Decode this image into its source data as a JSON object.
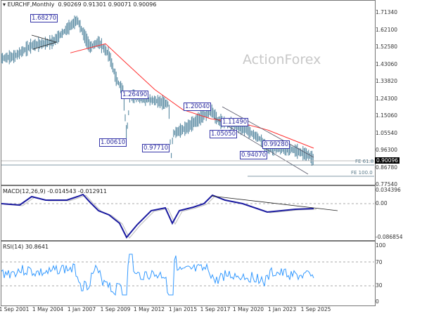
{
  "chart": {
    "symbol": "EURCHF,Monthly",
    "ohlc": "0.90269 0.91301 0.90071 0.90096",
    "watermark": "ActionForex",
    "current_price": "0.90096",
    "price_axis": [
      "1.71340",
      "1.62100",
      "1.52580",
      "1.43060",
      "1.33820",
      "1.24300",
      "1.15060",
      "1.05540",
      "0.96300",
      "0.86780",
      "0.77540"
    ],
    "labels": [
      "1.68270",
      "1.26490",
      "1.00610",
      "0.97710",
      "1.20040",
      "1.11490",
      "1.05050",
      "0.94070",
      "0.99280"
    ],
    "fe": [
      "FE 61.8",
      "FE 100.0"
    ]
  },
  "macd": {
    "title": "MACD(12,26,9) -0.014543 -0.012911",
    "axis": [
      "0.034396",
      "0.00",
      "-0.086854"
    ]
  },
  "rsi": {
    "title": "RSI(14) 30.8641",
    "axis": [
      "100",
      "70",
      "30",
      "0"
    ]
  },
  "x_axis": [
    "1 Sep 2001",
    "1 May 2004",
    "1 Jan 2007",
    "1 Sep 2009",
    "1 May 2012",
    "1 Jan 2015",
    "1 Sep 2017",
    "1 May 2020",
    "1 Jan 2023",
    "1 Sep 2025"
  ],
  "colors": {
    "price": "#4a7f9a",
    "ma": "#ff3030",
    "macd": "#1a1aa0",
    "rsi": "#3399ff"
  }
}
